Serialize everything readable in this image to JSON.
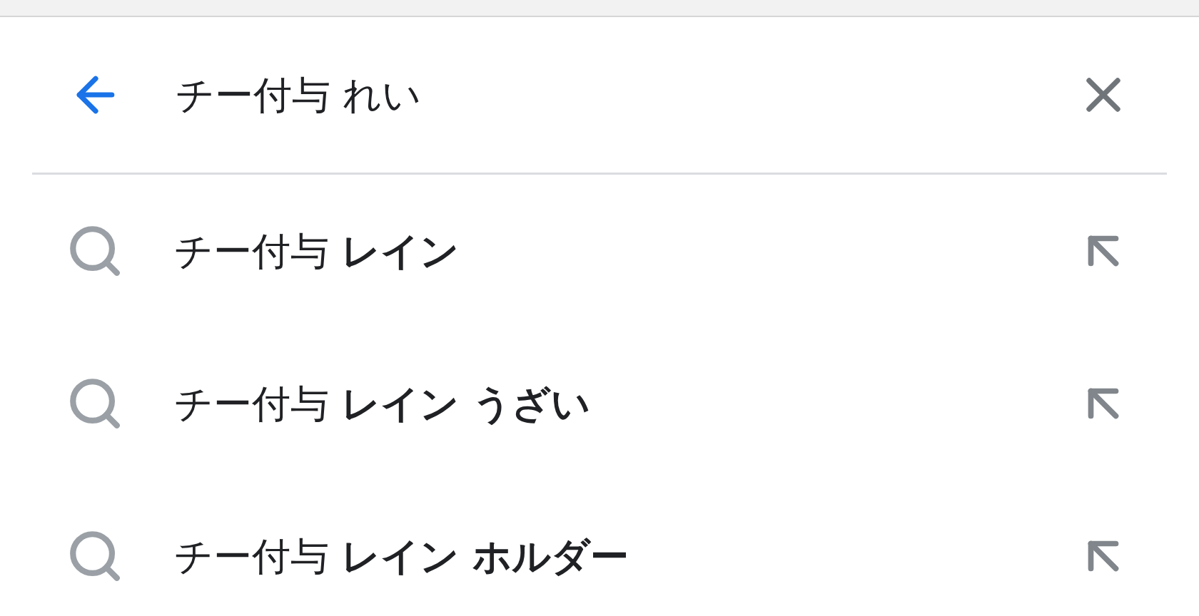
{
  "search": {
    "value": "チー付与 れい"
  },
  "suggestions": [
    {
      "text": "チー付与 **レイン**"
    },
    {
      "text": "チー付与 **レイン うざい**"
    },
    {
      "text": "チー付与 **レイン ホルダー**"
    }
  ]
}
